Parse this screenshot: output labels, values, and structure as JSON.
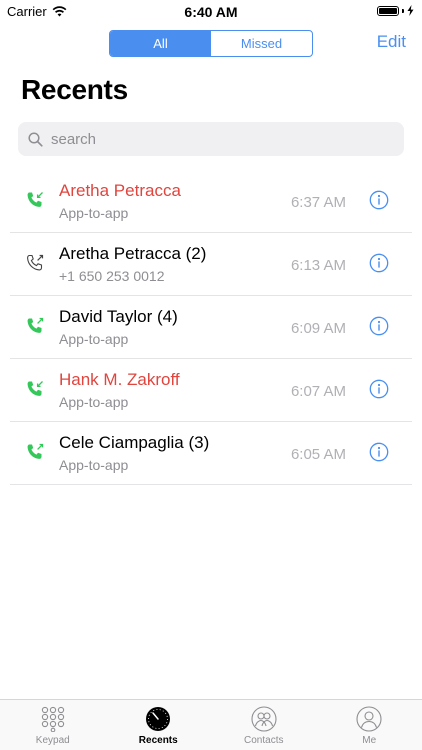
{
  "status_bar": {
    "carrier": "Carrier",
    "time": "6:40 AM",
    "battery_level": 1.0
  },
  "nav": {
    "segments": [
      {
        "label": "All",
        "selected": true
      },
      {
        "label": "Missed",
        "selected": false
      }
    ],
    "edit_label": "Edit"
  },
  "page_title": "Recents",
  "search": {
    "placeholder": "search",
    "value": ""
  },
  "calls": [
    {
      "name": "Aretha Petracca",
      "detail": "App-to-app",
      "time": "6:37 AM",
      "missed": true,
      "icon": "phone-incoming-green-icon"
    },
    {
      "name": "Aretha Petracca (2)",
      "detail": "+1 650 253 0012",
      "time": "6:13 AM",
      "missed": false,
      "icon": "phone-outgoing-icon"
    },
    {
      "name": "David Taylor (4)",
      "detail": "App-to-app",
      "time": "6:09 AM",
      "missed": false,
      "icon": "phone-outgoing-green-icon"
    },
    {
      "name": "Hank M. Zakroff",
      "detail": "App-to-app",
      "time": "6:07 AM",
      "missed": true,
      "icon": "phone-incoming-green-icon"
    },
    {
      "name": "Cele Ciampaglia (3)",
      "detail": "App-to-app",
      "time": "6:05 AM",
      "missed": false,
      "icon": "phone-outgoing-green-icon"
    }
  ],
  "tabs": [
    {
      "label": "Keypad",
      "icon": "keypad-icon",
      "active": false
    },
    {
      "label": "Recents",
      "icon": "clock-icon",
      "active": true
    },
    {
      "label": "Contacts",
      "icon": "contacts-icon",
      "active": false
    },
    {
      "label": "Me",
      "icon": "person-icon",
      "active": false
    }
  ],
  "colors": {
    "accent": "#4a8ff0",
    "missed": "#e0453e",
    "call_green": "#34c759",
    "secondary_text": "#8e8e93"
  }
}
